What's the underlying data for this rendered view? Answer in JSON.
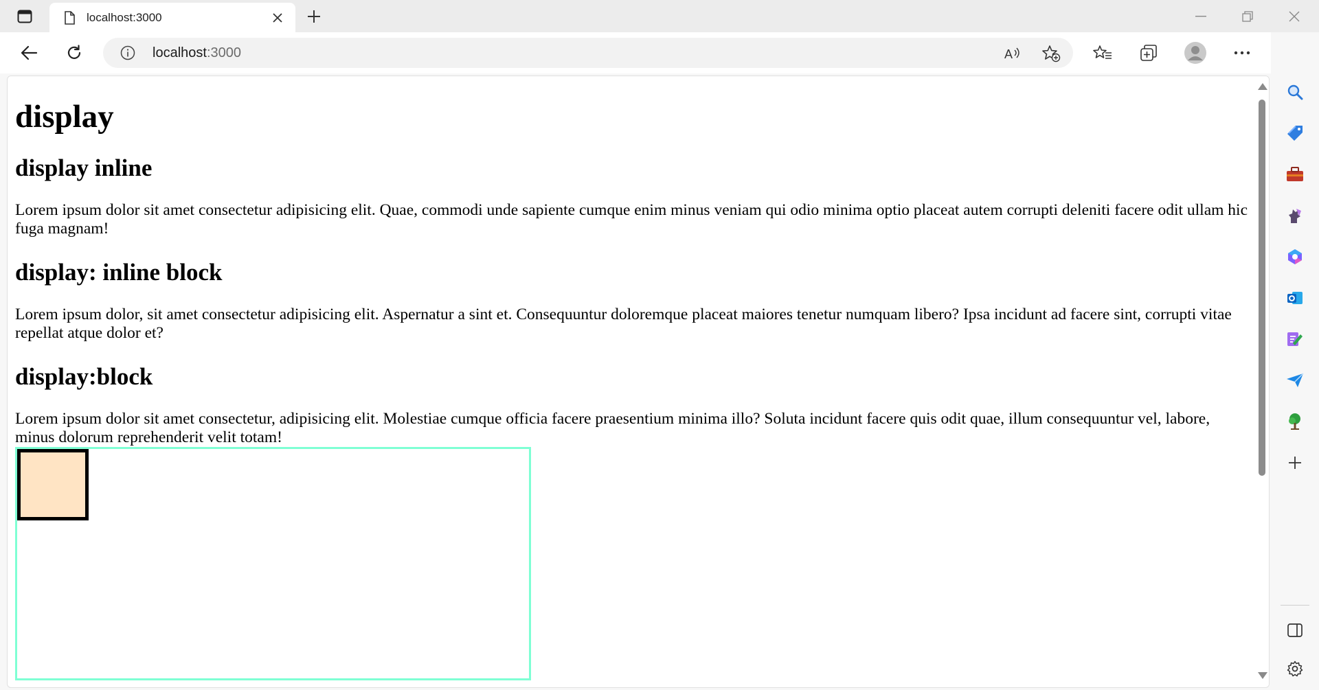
{
  "browser": {
    "tab": {
      "title": "localhost:3000"
    },
    "address": {
      "host": "localhost",
      "port": ":3000"
    }
  },
  "page": {
    "h1": "display",
    "sections": [
      {
        "heading": "display inline",
        "text": "Lorem ipsum dolor sit amet consectetur adipisicing elit. Quae, commodi unde sapiente cumque enim minus veniam qui odio minima optio placeat autem corrupti deleniti facere odit ullam hic fuga magnam!"
      },
      {
        "heading": "display: inline block",
        "text": "Lorem ipsum dolor, sit amet consectetur adipisicing elit. Aspernatur a sint et. Consequuntur doloremque placeat maiores tenetur numquam libero? Ipsa incidunt ad facere sint, corrupti vitae repellat atque dolor et?"
      },
      {
        "heading": "display:block",
        "text": "Lorem ipsum dolor sit amet consectetur, adipisicing elit. Molestiae cumque officia facere praesentium minima illo? Soluta incidunt facere quis odit quae, illum consequuntur vel, labore, minus dolorum reprehenderit velit totam!"
      }
    ],
    "box_colors": {
      "outer_border": "#7fffd4",
      "inner_fill": "#ffe4c4",
      "inner_border": "#000000"
    }
  },
  "icons": {
    "tab_actions": "tab-actions-icon",
    "favicon": "page-icon",
    "close_tab": "close-icon",
    "new_tab": "plus-icon",
    "back": "arrow-left-icon",
    "refresh": "refresh-icon",
    "site_info": "info-icon",
    "read_aloud": "read-aloud-icon",
    "add_favorite": "star-plus-icon",
    "favorites": "favorites-icon",
    "collections": "collections-icon",
    "profile": "avatar-icon",
    "more": "more-icon",
    "copilot": "bing-icon",
    "sidebar": [
      "search-icon",
      "shopping-tag-icon",
      "tools-icon",
      "games-icon",
      "microsoft365-icon",
      "outlook-icon",
      "designer-icon",
      "send-icon",
      "tree-icon",
      "add-icon"
    ],
    "sidebar_bottom": [
      "split-view-icon",
      "settings-icon"
    ]
  }
}
